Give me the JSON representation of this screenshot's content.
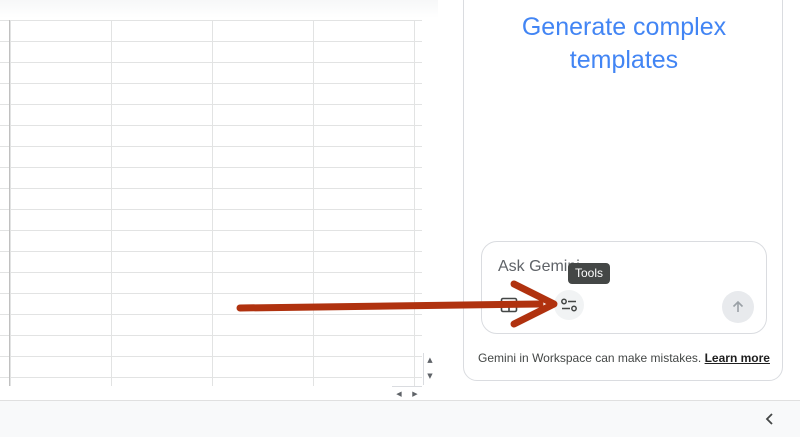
{
  "panel": {
    "title_line1": "Generate complex",
    "title_line2": "templates",
    "composer": {
      "placeholder": "Ask Gemini",
      "tooltip": "Tools"
    },
    "disclaimer": {
      "text": "Gemini in Workspace can make mistakes.",
      "link": "Learn more"
    }
  },
  "icons": {
    "sheet": "table-icon",
    "tools": "tools-sliders-icon",
    "send": "arrow-up-icon",
    "collapse": "chevron-left-icon"
  },
  "colors": {
    "title": "#4285f4",
    "annotation_arrow": "#b0320f",
    "grid_line": "#e2e3e3"
  }
}
